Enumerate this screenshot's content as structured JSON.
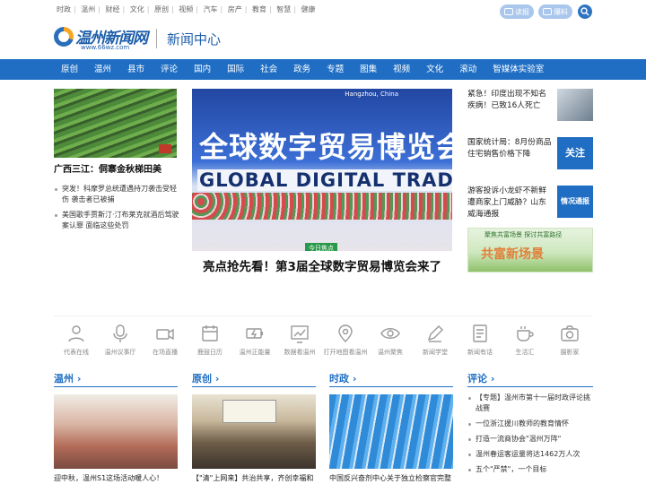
{
  "topbar": {
    "links": [
      "时政",
      "温州",
      "财经",
      "文化",
      "原创",
      "视频",
      "汽车",
      "房产",
      "教育",
      "智慧",
      "健康"
    ],
    "report_label": "读报",
    "tipoff_label": "爆料"
  },
  "header": {
    "logo_text": "温州新闻网",
    "logo_url": "www.66wz.com",
    "channel": "新闻中心"
  },
  "nav": {
    "items": [
      "原创",
      "温州",
      "县市",
      "评论",
      "国内",
      "国际",
      "社会",
      "政务",
      "专题",
      "图集",
      "视频",
      "文化",
      "滚动",
      "智媒体实验室"
    ]
  },
  "left": {
    "feature_title": "广西三江：侗寨金秋梯田美",
    "news": [
      "突发！科摩罗总统遭遇持刀袭击受轻伤 袭击者已被捕",
      "美国歌手贾斯汀·汀布莱克就酒后驾驶案认罪 面临这些处罚"
    ]
  },
  "hero": {
    "city": "Hangzhou, China",
    "slogan_cn": "全球数字贸易博览会",
    "slogan_en": "GLOBAL DIGITAL TRADE EXPO",
    "badge": "今日焦点",
    "title": "亮点抢先看！第3届全球数字贸易博览会来了"
  },
  "right": {
    "items": [
      {
        "text": "紧急！印度出现不知名疾病！已致16人死亡",
        "thumb": ""
      },
      {
        "text": "国家统计局：8月份商品住宅销售价格下降",
        "thumb": "关注"
      },
      {
        "text": "游客投诉小龙虾不新鲜遭商家上门威胁？山东威海通报",
        "thumb": "情况通报"
      }
    ],
    "banner_line1": "聚焦共富场景  探讨共富路径",
    "banner_line2": "共富新场景"
  },
  "iconbar": {
    "items": [
      {
        "label": "代表在线",
        "icon": "user-icon"
      },
      {
        "label": "温州议事厅",
        "icon": "microphone-icon"
      },
      {
        "label": "在场直播",
        "icon": "camera-icon"
      },
      {
        "label": "鹿鼓日历",
        "icon": "calendar-icon"
      },
      {
        "label": "温州正能量",
        "icon": "energy-icon"
      },
      {
        "label": "数据看温州",
        "icon": "chart-icon"
      },
      {
        "label": "打开地图看温州",
        "icon": "map-pin-icon"
      },
      {
        "label": "温州聚焦",
        "icon": "eye-icon"
      },
      {
        "label": "新闻学堂",
        "icon": "pen-icon"
      },
      {
        "label": "新闻有话",
        "icon": "document-icon"
      },
      {
        "label": "生活汇",
        "icon": "cup-icon"
      },
      {
        "label": "摄影家",
        "icon": "photo-icon"
      }
    ]
  },
  "sections": [
    {
      "title": "温州",
      "caption": "迎中秋，温州S1这场活动暖人心！"
    },
    {
      "title": "原创",
      "caption": "【\"清\"上网来】共治共享，齐创幸福和"
    },
    {
      "title": "时政",
      "caption": "中国反兴奋剂中心关于独立检察官完整"
    },
    {
      "title": "评论",
      "caption": ""
    }
  ],
  "opinion": {
    "items": [
      "【专题】温州市第十一届时政评论挑战赛",
      "一位浙江援川教师的教育情怀",
      "打造一流商协会\"温州万阵\"",
      "温州春运客运量将达1462万人次",
      "五个\"严禁\"，一个目标"
    ]
  },
  "colors": {
    "brand": "#1f6ec4",
    "accent": "#f6a623"
  }
}
